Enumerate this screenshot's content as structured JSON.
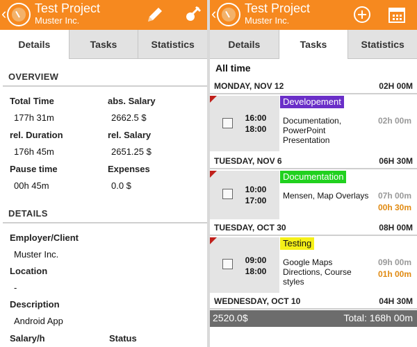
{
  "left": {
    "header": {
      "title": "Test Project",
      "subtitle": "Muster Inc."
    },
    "tabs": [
      {
        "label": "Details"
      },
      {
        "label": "Tasks"
      },
      {
        "label": "Statistics"
      }
    ],
    "overview": {
      "heading": "OVERVIEW",
      "total_time_label": "Total Time",
      "total_time_value": "177h 31m",
      "abs_salary_label": "abs. Salary",
      "abs_salary_value": "2662.5 $",
      "rel_duration_label": "rel. Duration",
      "rel_duration_value": "176h 45m",
      "rel_salary_label": "rel. Salary",
      "rel_salary_value": "2651.25 $",
      "pause_label": "Pause time",
      "pause_value": "00h 45m",
      "expenses_label": "Expenses",
      "expenses_value": "0.0 $"
    },
    "details": {
      "heading": "DETAILS",
      "employer_label": "Employer/Client",
      "employer_value": "Muster Inc.",
      "location_label": "Location",
      "location_value": "-",
      "description_label": "Description",
      "description_value": "Android App",
      "salary_label": "Salary/h",
      "status_label": "Status"
    }
  },
  "right": {
    "header": {
      "title": "Test Project",
      "subtitle": "Muster Inc."
    },
    "tabs": [
      {
        "label": "Details"
      },
      {
        "label": "Tasks"
      },
      {
        "label": "Statistics"
      }
    ],
    "filter": "All time",
    "days": [
      {
        "date": "MONDAY, NOV 12",
        "hours": "02H 00M"
      },
      {
        "date": "TUESDAY, NOV 6",
        "hours": "06H 30M"
      },
      {
        "date": "TUESDAY, OCT 30",
        "hours": "08H 00M"
      },
      {
        "date": "WEDNESDAY, OCT 10",
        "hours": "04H 30M"
      }
    ],
    "tasks": [
      {
        "start": "16:00",
        "end": "18:00",
        "tag": "Developement",
        "tag_color": "#6a2fc8",
        "tag_text_color": "#ffffff",
        "desc": "Documentation, PowerPoint Presentation",
        "hours": "02h 00m",
        "overtime": ""
      },
      {
        "start": "10:00",
        "end": "17:00",
        "tag": "Documentation",
        "tag_color": "#21d11f",
        "tag_text_color": "#ffffff",
        "desc": "Mensen, Map Overlays",
        "hours": "07h 00m",
        "overtime": "00h 30m"
      },
      {
        "start": "09:00",
        "end": "18:00",
        "tag": "Testing",
        "tag_color": "#f5f018",
        "tag_text_color": "#111111",
        "desc": "Google Maps Directions, Course styles",
        "hours": "09h 00m",
        "overtime": "01h 00m"
      }
    ],
    "footer": {
      "amount": "2520.0$",
      "total": "Total: 168h 00m"
    }
  },
  "colors": {
    "accent": "#f6891f",
    "footer": "#6c6c6c"
  },
  "icons": [
    "back-chevron-icon",
    "clock-logo-icon",
    "pencil-icon",
    "pin-icon",
    "add-circle-icon",
    "calendar-icon"
  ]
}
